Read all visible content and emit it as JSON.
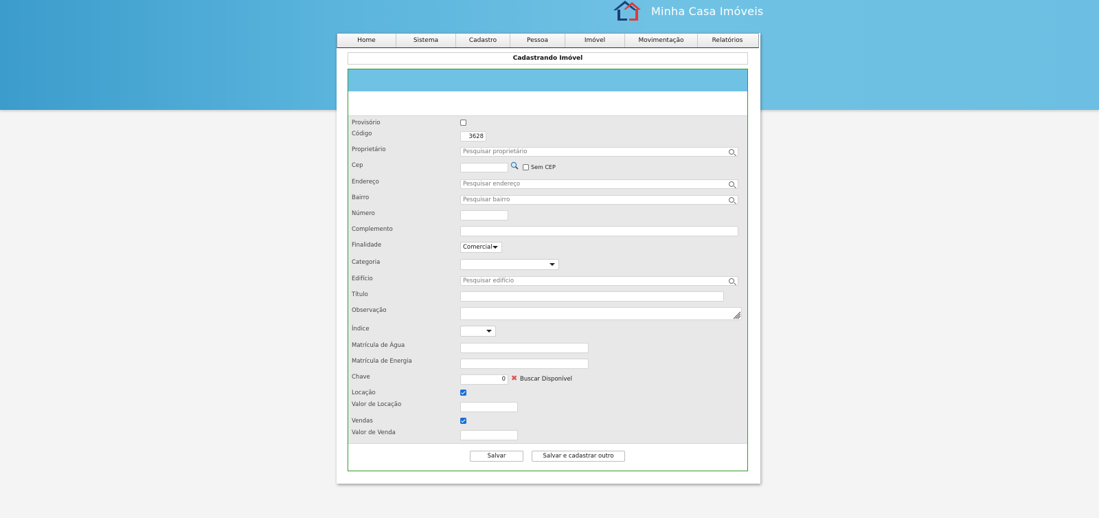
{
  "brand": {
    "name": "Minha Casa Imóveis"
  },
  "nav": {
    "items": [
      "Home",
      "Sistema",
      "Cadastro",
      "Pessoa",
      "Imóvel",
      "Movimentação",
      "Relatórios"
    ]
  },
  "page": {
    "title": "Cadastrando Imóvel"
  },
  "form": {
    "provisorio": {
      "label": "Provisório",
      "checked": false
    },
    "codigo": {
      "label": "Código",
      "value": "3628"
    },
    "proprietario": {
      "label": "Proprietário",
      "placeholder": "Pesquisar proprietário"
    },
    "cep": {
      "label": "Cep",
      "value": "",
      "sem_cep_label": "Sem CEP"
    },
    "endereco": {
      "label": "Endereço",
      "placeholder": "Pesquisar endereço"
    },
    "bairro": {
      "label": "Bairro",
      "placeholder": "Pesquisar bairro"
    },
    "numero": {
      "label": "Número",
      "value": ""
    },
    "complemento": {
      "label": "Complemento",
      "value": ""
    },
    "finalidade": {
      "label": "Finalidade",
      "value": "Comercial"
    },
    "categoria": {
      "label": "Categoria",
      "value": ""
    },
    "edificio": {
      "label": "Edifício",
      "placeholder": "Pesquisar edifício"
    },
    "titulo": {
      "label": "Título",
      "value": ""
    },
    "observacao": {
      "label": "Observação",
      "value": ""
    },
    "indice": {
      "label": "Índice",
      "value": ""
    },
    "matricula_agua": {
      "label": "Matrícula de Água",
      "value": ""
    },
    "matricula_energia": {
      "label": "Matrícula de Energia",
      "value": ""
    },
    "chave": {
      "label": "Chave",
      "value": "0",
      "buscar_label": "Buscar Disponível"
    },
    "locacao": {
      "label": "Locação",
      "checked": true
    },
    "valor_locacao": {
      "label": "Valor de Locação",
      "value": ""
    },
    "vendas": {
      "label": "Vendas",
      "checked": true
    },
    "valor_venda": {
      "label": "Valor de Venda",
      "value": ""
    }
  },
  "buttons": {
    "save": "Salvar",
    "save_and_new": "Salvar e cadastrar outro"
  },
  "colors": {
    "accent_blue": "#70c2e4",
    "panel_border": "#2f9b2f",
    "checkbox_blue": "#1a6ed8"
  }
}
